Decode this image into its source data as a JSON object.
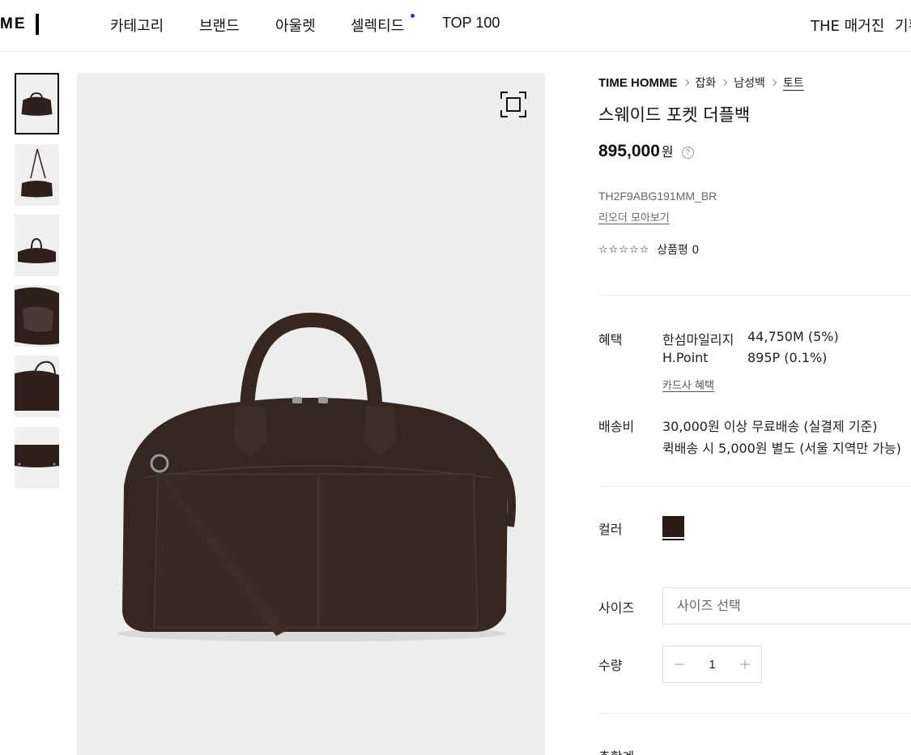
{
  "header": {
    "logo": "ME",
    "nav": [
      "카테고리",
      "브랜드",
      "아울렛",
      "셀렉티드",
      "TOP 100"
    ],
    "right_nav": [
      "THE 매거진",
      "기획"
    ]
  },
  "gallery": {
    "thumbnail_count": 6,
    "zoom_icon": "fullscreen-icon"
  },
  "product": {
    "breadcrumb": [
      "TIME HOMME",
      "잡화",
      "남성백",
      "토트"
    ],
    "title": "스웨이드 포켓 더플백",
    "price": "895,000",
    "price_unit": "원",
    "help_icon_glyph": "?",
    "sku": "TH2F9ABG191MM_BR",
    "reorder_label": "리오더 모아보기",
    "stars": "☆☆☆☆☆",
    "rating_text": "상품평 0"
  },
  "benefits": {
    "label": "혜택",
    "items": [
      {
        "name": "한섬마일리지",
        "value": "44,750M (5%)"
      },
      {
        "name": "H.Point",
        "value": "895P (0.1%)"
      }
    ],
    "card_link": "카드사 혜택"
  },
  "shipping": {
    "label": "배송비",
    "lines": [
      "30,000원 이상 무료배송 (실결제 기준)",
      "퀵배송 시 5,000원 별도 (서울 지역만 가능)"
    ]
  },
  "options": {
    "color_label": "컬러",
    "color_hex": "#2a1a18",
    "size_label": "사이즈",
    "size_placeholder": "사이즈 선택",
    "qty_label": "수량",
    "qty_value": "1",
    "qty_minus": "−",
    "qty_plus": "+"
  },
  "next_section_label": "총합계"
}
